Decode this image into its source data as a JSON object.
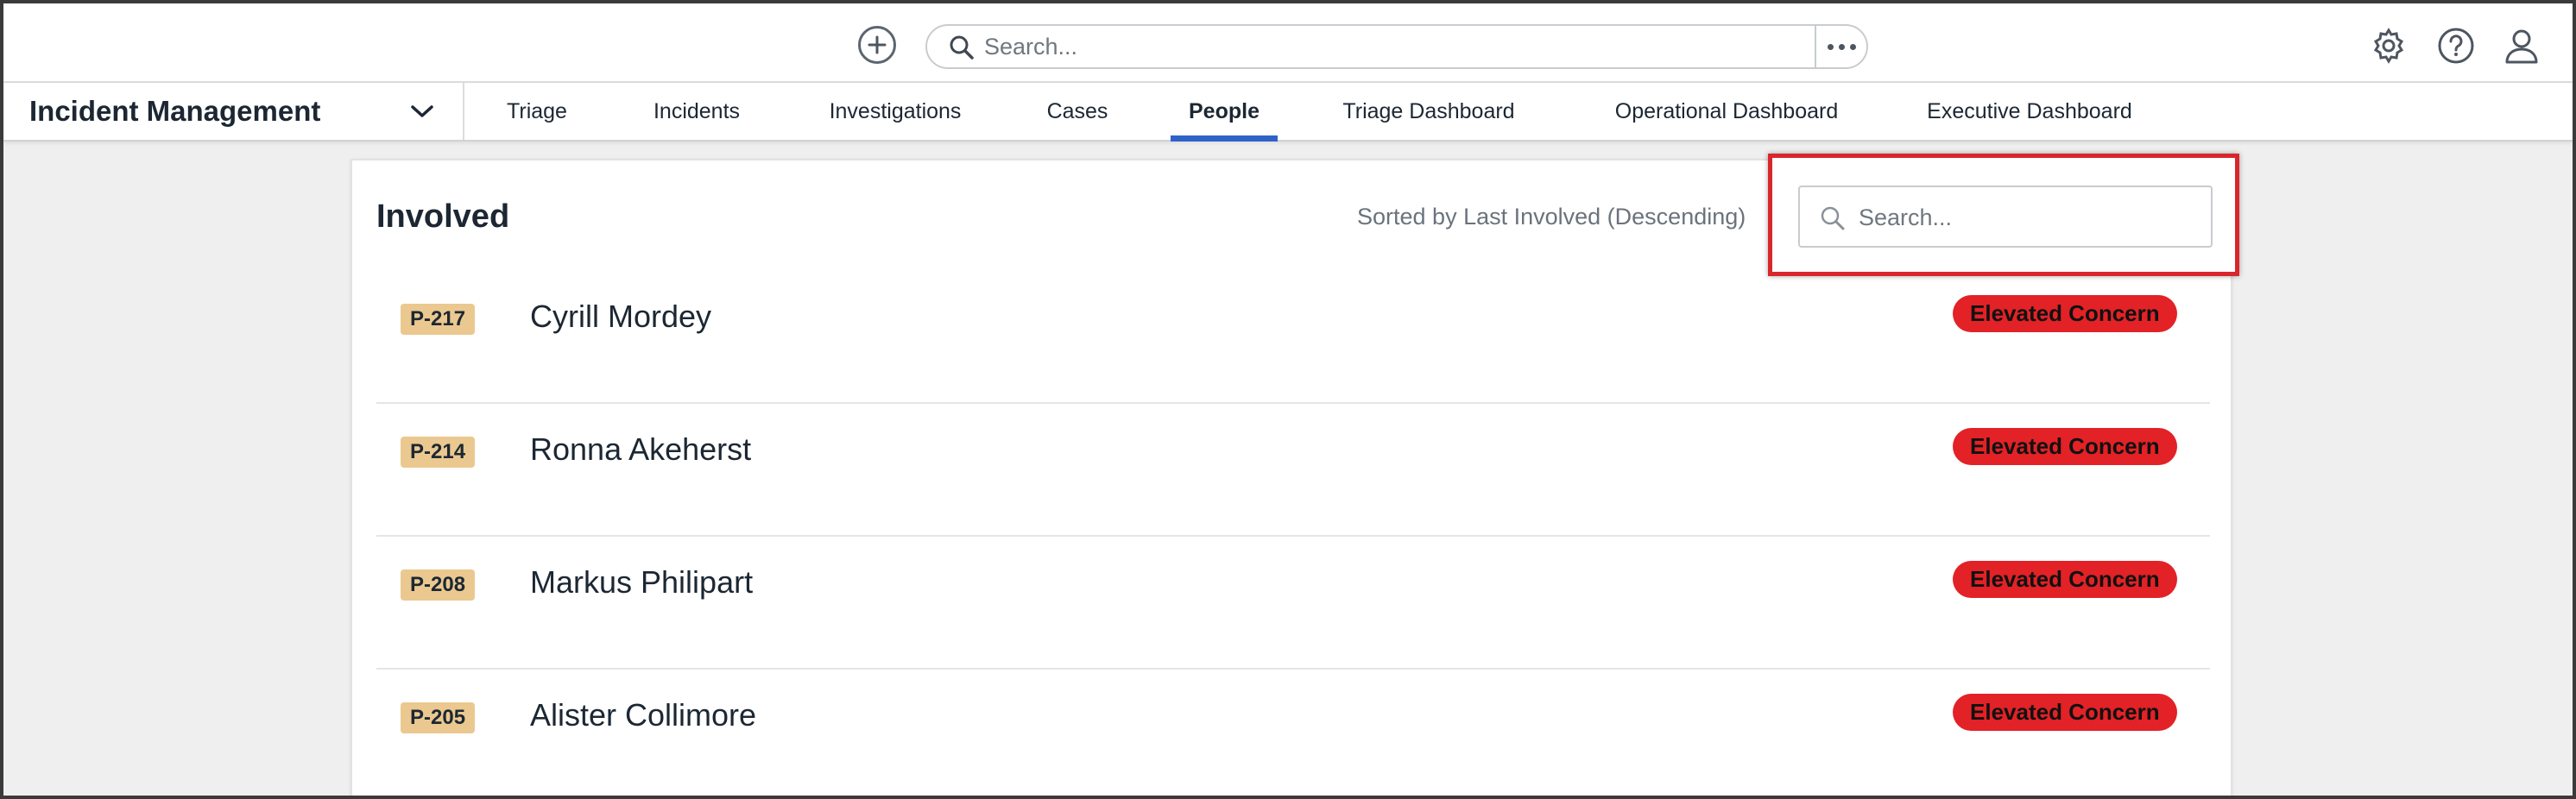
{
  "header": {
    "search_placeholder": "Search...",
    "icons": [
      "add-icon",
      "search-icon",
      "more-icon",
      "gear-icon",
      "help-icon",
      "user-icon"
    ]
  },
  "nav": {
    "app_title": "Incident Management",
    "tabs": [
      {
        "label": "Triage"
      },
      {
        "label": "Incidents"
      },
      {
        "label": "Investigations"
      },
      {
        "label": "Cases"
      },
      {
        "label": "People"
      },
      {
        "label": "Triage Dashboard"
      },
      {
        "label": "Operational Dashboard"
      },
      {
        "label": "Executive Dashboard"
      }
    ],
    "active_tab": "People"
  },
  "involved": {
    "title": "Involved",
    "sort_text": "Sorted by Last Involved (Descending)",
    "search_placeholder": "Search...",
    "rows": [
      {
        "id": "P-217",
        "name": "Cyrill Mordey",
        "status": "Elevated Concern"
      },
      {
        "id": "P-214",
        "name": "Ronna Akeherst",
        "status": "Elevated Concern"
      },
      {
        "id": "P-208",
        "name": "Markus Philipart",
        "status": "Elevated Concern"
      },
      {
        "id": "P-205",
        "name": "Alister Collimore",
        "status": "Elevated Concern"
      }
    ]
  },
  "colors": {
    "accent": "#2f62c9",
    "id_badge": "#ebc88f",
    "concern_badge": "#e22226",
    "highlight_border": "#d9262c"
  }
}
